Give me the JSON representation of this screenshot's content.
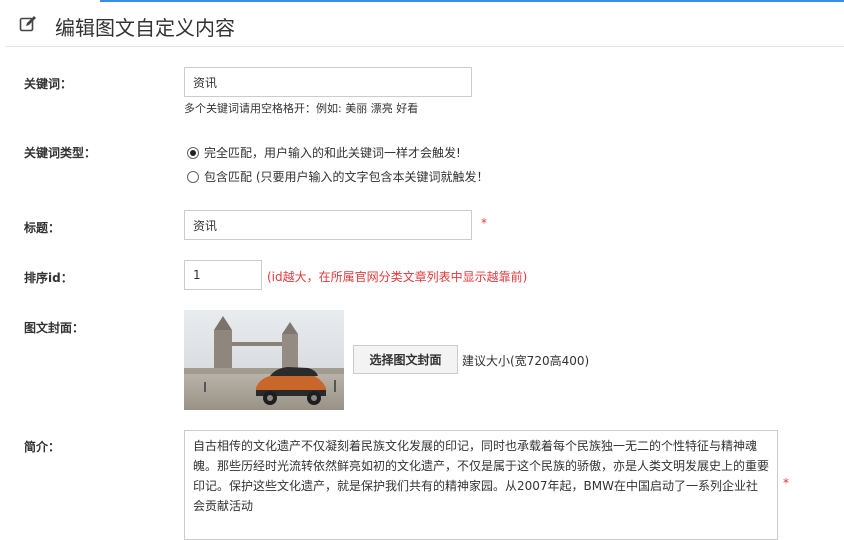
{
  "header": {
    "title": "编辑图文自定义内容"
  },
  "keyword": {
    "label": "关键词：",
    "value": "资讯",
    "hint": "多个关键词请用空格格开：例如: 美丽 漂亮 好看"
  },
  "keyword_type": {
    "label": "关键词类型：",
    "options": [
      {
        "text": "完全匹配，用户输入的和此关键词一样才会触发!",
        "checked": true
      },
      {
        "text": "包含匹配 (只要用户输入的文字包含本关键词就触发！",
        "checked": false
      }
    ]
  },
  "title_field": {
    "label": "标题：",
    "value": "资讯",
    "required_mark": "*"
  },
  "sort": {
    "label": "排序id：",
    "value": "1",
    "note": "(id越大，在所属官网分类文章列表中显示越靠前)"
  },
  "cover": {
    "label": "图文封面：",
    "button": "选择图文封面",
    "size_hint": "建议大小(宽720高400)"
  },
  "summary": {
    "label": "简介：",
    "value": "自古相传的文化遗产不仅凝刻着民族文化发展的印记，同时也承载着每个民族独一无二的个性特征与精神魂魄。那些历经时光流转依然鲜亮如初的文化遗产，不仅是属于这个民族的骄傲，亦是人类文明发展史上的重要印记。保护这些文化遗产，就是保护我们共有的精神家园。从2007年起，BMW在中国启动了一系列企业社会贡献活动",
    "required_mark": "*"
  }
}
